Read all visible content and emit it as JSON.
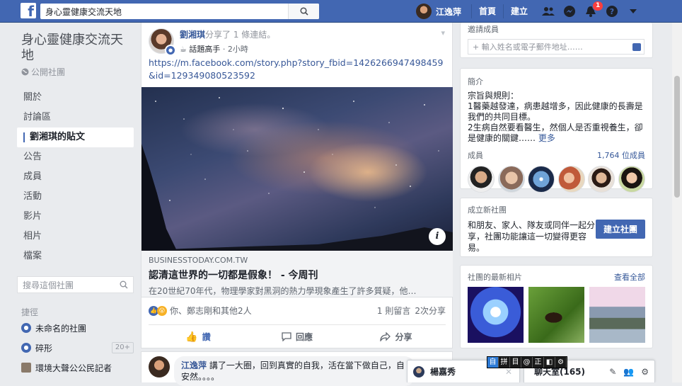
{
  "topbar": {
    "logo": "f",
    "search_value": "身心靈健康交流天地",
    "user_name": "江逸萍",
    "home_label": "首頁",
    "create_label": "建立",
    "notification_count": "1"
  },
  "leftnav": {
    "group_name": "身心靈健康交流天地",
    "group_type": "公開社團",
    "items": [
      {
        "label": "關於"
      },
      {
        "label": "討論區"
      },
      {
        "label": "劉湘琪的貼文"
      },
      {
        "label": "公告"
      },
      {
        "label": "成員"
      },
      {
        "label": "活動"
      },
      {
        "label": "影片"
      },
      {
        "label": "相片"
      },
      {
        "label": "檔案"
      }
    ],
    "search_placeholder": "搜尋這個社團",
    "shortcuts_title": "捷徑",
    "shortcuts": [
      {
        "label": "未命名的社團",
        "count": ""
      },
      {
        "label": "碎形",
        "count": "20+"
      },
      {
        "label": "環境大聲公公民記者",
        "count": ""
      }
    ]
  },
  "post": {
    "author": "劉湘琪",
    "action_text": "分享了 1 條連結。",
    "badge": "話題高手",
    "time": "2小時",
    "url": "https://m.facebook.com/story.php?story_fbid=1426266947498459&id=129349080523592",
    "link_domain": "BUSINESSTODAY.COM.TW",
    "link_title": "認清這世界的一切都是假象！ - 今周刊",
    "link_desc": "在20世紀70年代，物理學家對黑洞的熱力學現象產生了許多質疑，他…",
    "reactions_text": "你、鄭志剛和其他2人",
    "comments_count": "1 則留言",
    "shares_count": "2次分享",
    "like_label": "讚",
    "comment_label": "回應",
    "share_label": "分享"
  },
  "comment": {
    "author": "江逸萍",
    "text": "講了一大圈，回到真實的自我，活在當下做自己，自",
    "text2": "安然。。。。"
  },
  "right": {
    "invite_title": "邀請成員",
    "invite_placeholder": "+ 輸入姓名或電子郵件地址……",
    "about_title": "簡介",
    "about_lines": [
      "宗旨與規則：",
      "1醫藥越發達，病患越增多，因此健康的長壽是我們的共同目標。",
      "2生病自然要看醫生，然個人是否重視養生，卻是健康的關鍵……"
    ],
    "about_more": "更多",
    "members_label": "成員",
    "members_count": "1,764 位成員",
    "create_title": "成立新社團",
    "create_text": "和朋友、家人、隊友或同伴一起分享，社團功能讓這一切變得更容易。",
    "create_button": "建立社團",
    "photos_title": "社團的最新相片",
    "photos_see_all": "查看全部"
  },
  "chat": {
    "friend_name": "楊嘉秀",
    "room_label": "聊天室(165)",
    "ime_keys": [
      "自",
      "拼",
      "目",
      "@",
      "正",
      "◧",
      "⚙"
    ]
  },
  "colors": {
    "brand": "#4267b2",
    "link": "#385898",
    "background": "#e9ebee"
  }
}
